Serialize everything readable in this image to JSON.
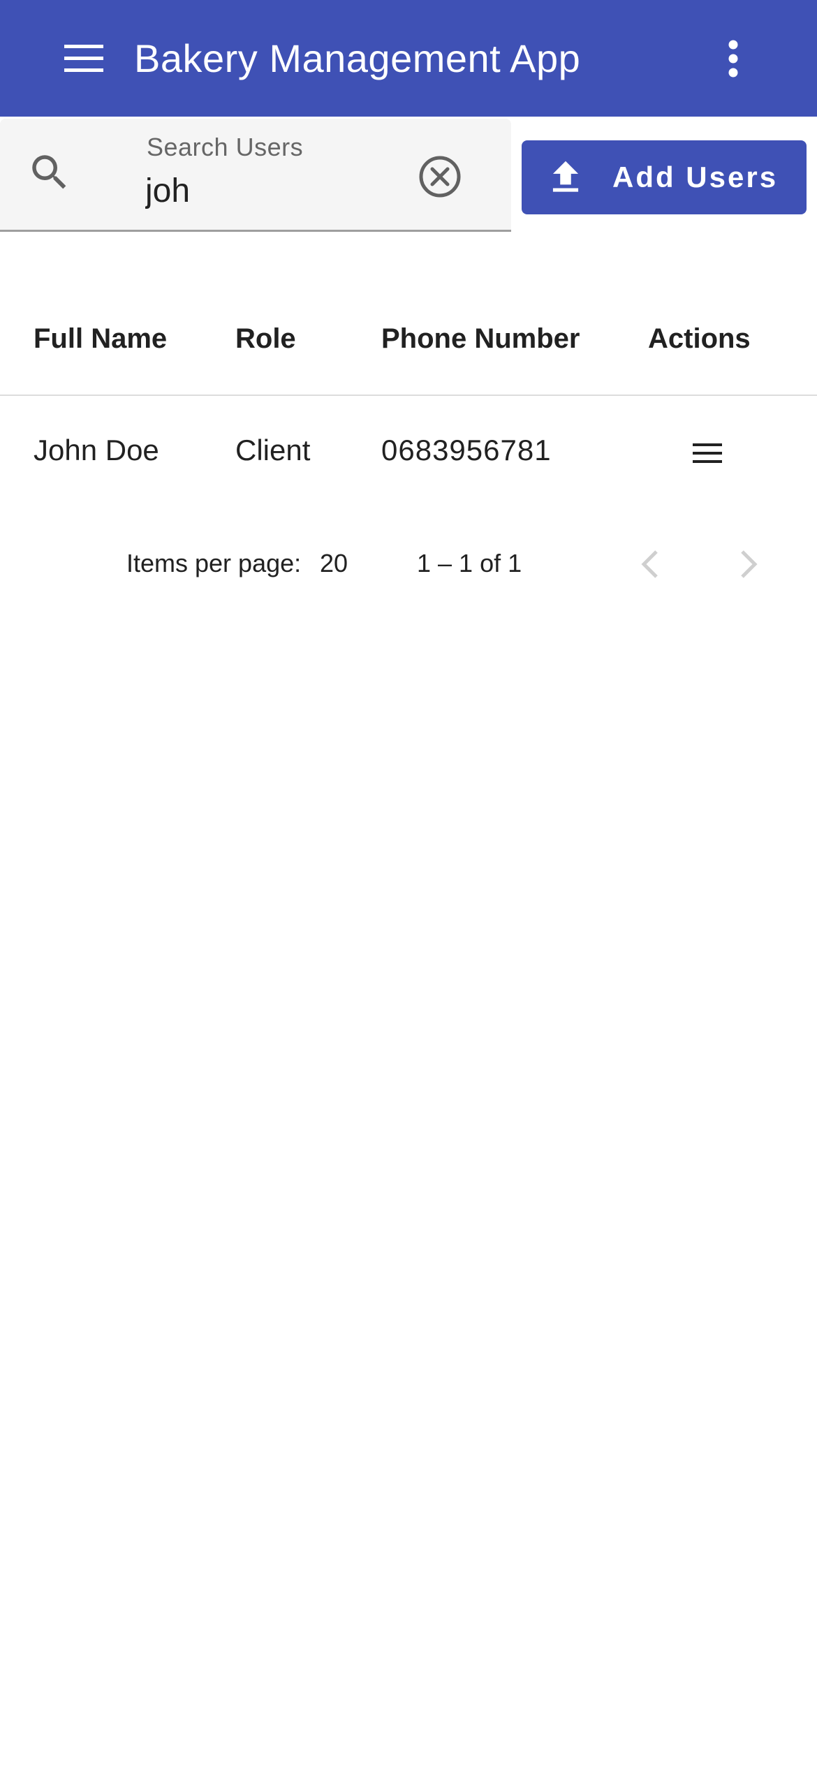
{
  "app_bar": {
    "title": "Bakery Management App",
    "background_color": "#3f51b5",
    "menu_icon": "hamburger-menu-icon",
    "more_icon": "more-vert-icon"
  },
  "search": {
    "label": "Search Users",
    "value": "joh",
    "search_icon": "search-icon",
    "clear_icon": "clear-circle-icon"
  },
  "add_button": {
    "label": "Add Users",
    "icon": "upload-icon",
    "color": "#3f51b5"
  },
  "table": {
    "columns": [
      "Full Name",
      "Role",
      "Phone Number",
      "Actions"
    ],
    "rows": [
      {
        "full_name": "John Doe",
        "role": "Client",
        "phone": "0683956781",
        "action_icon": "menu-icon"
      }
    ]
  },
  "paginator": {
    "items_per_page_label": "Items per page:",
    "page_size": "20",
    "range": "1 – 1 of 1",
    "prev_icon": "chevron-left-icon",
    "next_icon": "chevron-right-icon",
    "prev_enabled": false,
    "next_enabled": false
  }
}
